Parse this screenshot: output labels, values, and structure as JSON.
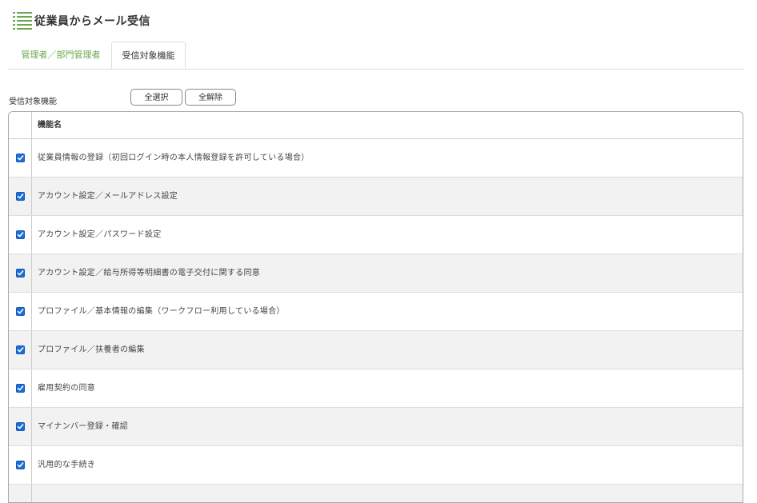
{
  "header": {
    "title": "従業員からメール受信",
    "icon": "list-icon"
  },
  "tabs": [
    {
      "label": "管理者／部門管理者",
      "active": false
    },
    {
      "label": "受信対象機能",
      "active": true
    }
  ],
  "section": {
    "label": "受信対象機能"
  },
  "buttons": {
    "select_all": "全選択",
    "deselect_all": "全解除"
  },
  "table": {
    "header": {
      "name": "機能名"
    },
    "rows": [
      {
        "label": "従業員情報の登録（初回ログイン時の本人情報登録を許可している場合）",
        "checked": true
      },
      {
        "label": "アカウント設定／メールアドレス設定",
        "checked": true
      },
      {
        "label": "アカウント設定／パスワード設定",
        "checked": true
      },
      {
        "label": "アカウント設定／給与所得等明細書の電子交付に関する同意",
        "checked": true
      },
      {
        "label": "プロファイル／基本情報の編集（ワークフロー利用している場合）",
        "checked": true
      },
      {
        "label": "プロファイル／扶養者の編集",
        "checked": true
      },
      {
        "label": "雇用契約の同意",
        "checked": true
      },
      {
        "label": "マイナンバー登録・確認",
        "checked": true
      },
      {
        "label": "汎用的な手続き",
        "checked": true
      },
      {
        "label": "",
        "checked": false
      }
    ]
  },
  "colors": {
    "accent": "#6aa84f",
    "checkbox": "#1a6ed8"
  }
}
